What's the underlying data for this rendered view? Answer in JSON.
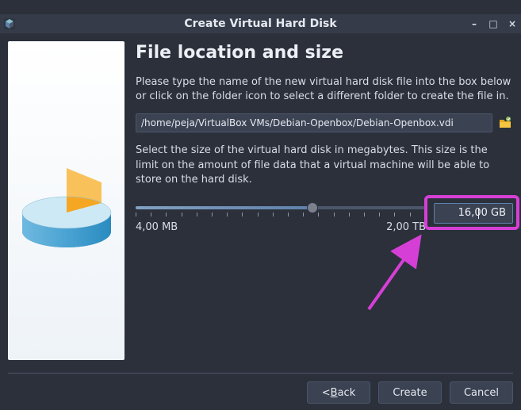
{
  "window": {
    "title": "Create Virtual Hard Disk"
  },
  "page": {
    "heading": "File location and size",
    "desc_path": "Please type the name of the new virtual hard disk file into the box below or click on the folder icon to select a different folder to create the file in.",
    "desc_size": "Select the size of the virtual hard disk in megabytes. This size is the limit on the amount of file data that a virtual machine will be able to store on the hard disk."
  },
  "form": {
    "file_path": "/home/peja/VirtualBox VMs/Debian-Openbox/Debian-Openbox.vdi",
    "size_value": "16,00 GB",
    "size_min_label": "4,00 MB",
    "size_max_label": "2,00 TB"
  },
  "buttons": {
    "back_prefix": "< ",
    "back_key": "B",
    "back_rest": "ack",
    "create": "Create",
    "cancel": "Cancel"
  }
}
